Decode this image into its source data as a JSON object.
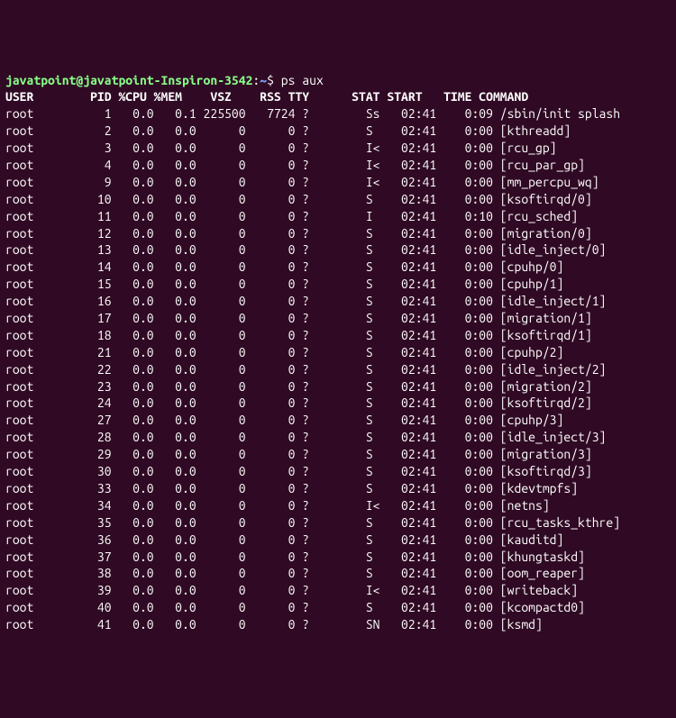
{
  "prompt": {
    "user_host": "javatpoint@javatpoint-Inspiron-3542",
    "colon": ":",
    "path": "~",
    "dollar": "$",
    "command": "ps aux"
  },
  "header": {
    "user": "USER",
    "pid": "PID",
    "cpu": "%CPU",
    "mem": "%MEM",
    "vsz": "VSZ",
    "rss": "RSS",
    "tty": "TTY",
    "stat": "STAT",
    "start": "START",
    "time": "TIME",
    "command": "COMMAND"
  },
  "rows": [
    {
      "user": "root",
      "pid": "1",
      "cpu": "0.0",
      "mem": "0.1",
      "vsz": "225500",
      "rss": "7724",
      "tty": "?",
      "stat": "Ss",
      "start": "02:41",
      "time": "0:09",
      "command": "/sbin/init splash"
    },
    {
      "user": "root",
      "pid": "2",
      "cpu": "0.0",
      "mem": "0.0",
      "vsz": "0",
      "rss": "0",
      "tty": "?",
      "stat": "S",
      "start": "02:41",
      "time": "0:00",
      "command": "[kthreadd]"
    },
    {
      "user": "root",
      "pid": "3",
      "cpu": "0.0",
      "mem": "0.0",
      "vsz": "0",
      "rss": "0",
      "tty": "?",
      "stat": "I<",
      "start": "02:41",
      "time": "0:00",
      "command": "[rcu_gp]"
    },
    {
      "user": "root",
      "pid": "4",
      "cpu": "0.0",
      "mem": "0.0",
      "vsz": "0",
      "rss": "0",
      "tty": "?",
      "stat": "I<",
      "start": "02:41",
      "time": "0:00",
      "command": "[rcu_par_gp]"
    },
    {
      "user": "root",
      "pid": "9",
      "cpu": "0.0",
      "mem": "0.0",
      "vsz": "0",
      "rss": "0",
      "tty": "?",
      "stat": "I<",
      "start": "02:41",
      "time": "0:00",
      "command": "[mm_percpu_wq]"
    },
    {
      "user": "root",
      "pid": "10",
      "cpu": "0.0",
      "mem": "0.0",
      "vsz": "0",
      "rss": "0",
      "tty": "?",
      "stat": "S",
      "start": "02:41",
      "time": "0:00",
      "command": "[ksoftirqd/0]"
    },
    {
      "user": "root",
      "pid": "11",
      "cpu": "0.0",
      "mem": "0.0",
      "vsz": "0",
      "rss": "0",
      "tty": "?",
      "stat": "I",
      "start": "02:41",
      "time": "0:10",
      "command": "[rcu_sched]"
    },
    {
      "user": "root",
      "pid": "12",
      "cpu": "0.0",
      "mem": "0.0",
      "vsz": "0",
      "rss": "0",
      "tty": "?",
      "stat": "S",
      "start": "02:41",
      "time": "0:00",
      "command": "[migration/0]"
    },
    {
      "user": "root",
      "pid": "13",
      "cpu": "0.0",
      "mem": "0.0",
      "vsz": "0",
      "rss": "0",
      "tty": "?",
      "stat": "S",
      "start": "02:41",
      "time": "0:00",
      "command": "[idle_inject/0]"
    },
    {
      "user": "root",
      "pid": "14",
      "cpu": "0.0",
      "mem": "0.0",
      "vsz": "0",
      "rss": "0",
      "tty": "?",
      "stat": "S",
      "start": "02:41",
      "time": "0:00",
      "command": "[cpuhp/0]"
    },
    {
      "user": "root",
      "pid": "15",
      "cpu": "0.0",
      "mem": "0.0",
      "vsz": "0",
      "rss": "0",
      "tty": "?",
      "stat": "S",
      "start": "02:41",
      "time": "0:00",
      "command": "[cpuhp/1]"
    },
    {
      "user": "root",
      "pid": "16",
      "cpu": "0.0",
      "mem": "0.0",
      "vsz": "0",
      "rss": "0",
      "tty": "?",
      "stat": "S",
      "start": "02:41",
      "time": "0:00",
      "command": "[idle_inject/1]"
    },
    {
      "user": "root",
      "pid": "17",
      "cpu": "0.0",
      "mem": "0.0",
      "vsz": "0",
      "rss": "0",
      "tty": "?",
      "stat": "S",
      "start": "02:41",
      "time": "0:00",
      "command": "[migration/1]"
    },
    {
      "user": "root",
      "pid": "18",
      "cpu": "0.0",
      "mem": "0.0",
      "vsz": "0",
      "rss": "0",
      "tty": "?",
      "stat": "S",
      "start": "02:41",
      "time": "0:00",
      "command": "[ksoftirqd/1]"
    },
    {
      "user": "root",
      "pid": "21",
      "cpu": "0.0",
      "mem": "0.0",
      "vsz": "0",
      "rss": "0",
      "tty": "?",
      "stat": "S",
      "start": "02:41",
      "time": "0:00",
      "command": "[cpuhp/2]"
    },
    {
      "user": "root",
      "pid": "22",
      "cpu": "0.0",
      "mem": "0.0",
      "vsz": "0",
      "rss": "0",
      "tty": "?",
      "stat": "S",
      "start": "02:41",
      "time": "0:00",
      "command": "[idle_inject/2]"
    },
    {
      "user": "root",
      "pid": "23",
      "cpu": "0.0",
      "mem": "0.0",
      "vsz": "0",
      "rss": "0",
      "tty": "?",
      "stat": "S",
      "start": "02:41",
      "time": "0:00",
      "command": "[migration/2]"
    },
    {
      "user": "root",
      "pid": "24",
      "cpu": "0.0",
      "mem": "0.0",
      "vsz": "0",
      "rss": "0",
      "tty": "?",
      "stat": "S",
      "start": "02:41",
      "time": "0:00",
      "command": "[ksoftirqd/2]"
    },
    {
      "user": "root",
      "pid": "27",
      "cpu": "0.0",
      "mem": "0.0",
      "vsz": "0",
      "rss": "0",
      "tty": "?",
      "stat": "S",
      "start": "02:41",
      "time": "0:00",
      "command": "[cpuhp/3]"
    },
    {
      "user": "root",
      "pid": "28",
      "cpu": "0.0",
      "mem": "0.0",
      "vsz": "0",
      "rss": "0",
      "tty": "?",
      "stat": "S",
      "start": "02:41",
      "time": "0:00",
      "command": "[idle_inject/3]"
    },
    {
      "user": "root",
      "pid": "29",
      "cpu": "0.0",
      "mem": "0.0",
      "vsz": "0",
      "rss": "0",
      "tty": "?",
      "stat": "S",
      "start": "02:41",
      "time": "0:00",
      "command": "[migration/3]"
    },
    {
      "user": "root",
      "pid": "30",
      "cpu": "0.0",
      "mem": "0.0",
      "vsz": "0",
      "rss": "0",
      "tty": "?",
      "stat": "S",
      "start": "02:41",
      "time": "0:00",
      "command": "[ksoftirqd/3]"
    },
    {
      "user": "root",
      "pid": "33",
      "cpu": "0.0",
      "mem": "0.0",
      "vsz": "0",
      "rss": "0",
      "tty": "?",
      "stat": "S",
      "start": "02:41",
      "time": "0:00",
      "command": "[kdevtmpfs]"
    },
    {
      "user": "root",
      "pid": "34",
      "cpu": "0.0",
      "mem": "0.0",
      "vsz": "0",
      "rss": "0",
      "tty": "?",
      "stat": "I<",
      "start": "02:41",
      "time": "0:00",
      "command": "[netns]"
    },
    {
      "user": "root",
      "pid": "35",
      "cpu": "0.0",
      "mem": "0.0",
      "vsz": "0",
      "rss": "0",
      "tty": "?",
      "stat": "S",
      "start": "02:41",
      "time": "0:00",
      "command": "[rcu_tasks_kthre]"
    },
    {
      "user": "root",
      "pid": "36",
      "cpu": "0.0",
      "mem": "0.0",
      "vsz": "0",
      "rss": "0",
      "tty": "?",
      "stat": "S",
      "start": "02:41",
      "time": "0:00",
      "command": "[kauditd]"
    },
    {
      "user": "root",
      "pid": "37",
      "cpu": "0.0",
      "mem": "0.0",
      "vsz": "0",
      "rss": "0",
      "tty": "?",
      "stat": "S",
      "start": "02:41",
      "time": "0:00",
      "command": "[khungtaskd]"
    },
    {
      "user": "root",
      "pid": "38",
      "cpu": "0.0",
      "mem": "0.0",
      "vsz": "0",
      "rss": "0",
      "tty": "?",
      "stat": "S",
      "start": "02:41",
      "time": "0:00",
      "command": "[oom_reaper]"
    },
    {
      "user": "root",
      "pid": "39",
      "cpu": "0.0",
      "mem": "0.0",
      "vsz": "0",
      "rss": "0",
      "tty": "?",
      "stat": "I<",
      "start": "02:41",
      "time": "0:00",
      "command": "[writeback]"
    },
    {
      "user": "root",
      "pid": "40",
      "cpu": "0.0",
      "mem": "0.0",
      "vsz": "0",
      "rss": "0",
      "tty": "?",
      "stat": "S",
      "start": "02:41",
      "time": "0:00",
      "command": "[kcompactd0]"
    },
    {
      "user": "root",
      "pid": "41",
      "cpu": "0.0",
      "mem": "0.0",
      "vsz": "0",
      "rss": "0",
      "tty": "?",
      "stat": "SN",
      "start": "02:41",
      "time": "0:00",
      "command": "[ksmd]"
    }
  ]
}
